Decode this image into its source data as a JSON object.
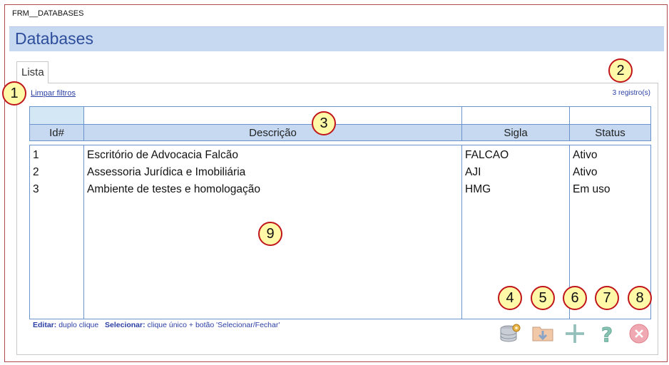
{
  "form": {
    "name": "FRM__DATABASES",
    "title": "Databases"
  },
  "tabs": [
    {
      "label": "Lista",
      "active": true
    }
  ],
  "toolbar": {
    "clear_filters": "Limpar filtros",
    "record_count": "3 registro(s)"
  },
  "grid": {
    "columns": [
      "Id#",
      "Descrição",
      "Sigla",
      "Status"
    ],
    "rows": [
      {
        "id": "1",
        "descricao": "Escritório de Advocacia Falcão",
        "sigla": "FALCAO",
        "status": "Ativo"
      },
      {
        "id": "2",
        "descricao": "Assessoria Jurídica e Imobiliária",
        "sigla": "AJI",
        "status": "Ativo"
      },
      {
        "id": "3",
        "descricao": "Ambiente de testes e homologação",
        "sigla": "HMG",
        "status": "Em uso"
      }
    ]
  },
  "hint": {
    "edit_label": "Editar:",
    "edit_text": "duplo clique",
    "select_label": "Selecionar:",
    "select_text": "clique único + botão 'Selecionar/Fechar'"
  },
  "buttons": [
    {
      "icon": "database-settings-icon"
    },
    {
      "icon": "folder-export-icon"
    },
    {
      "icon": "plus-icon"
    },
    {
      "icon": "help-icon"
    },
    {
      "icon": "close-circle-icon"
    }
  ],
  "callouts": [
    "1",
    "2",
    "3",
    "4",
    "5",
    "6",
    "7",
    "8",
    "9"
  ],
  "colors": {
    "header_bg": "#c6d9f1",
    "title_text": "#2e4d9b",
    "callout_fill": "#fff9a8",
    "callout_border": "#c0151b",
    "frame_border": "#b0484f"
  }
}
